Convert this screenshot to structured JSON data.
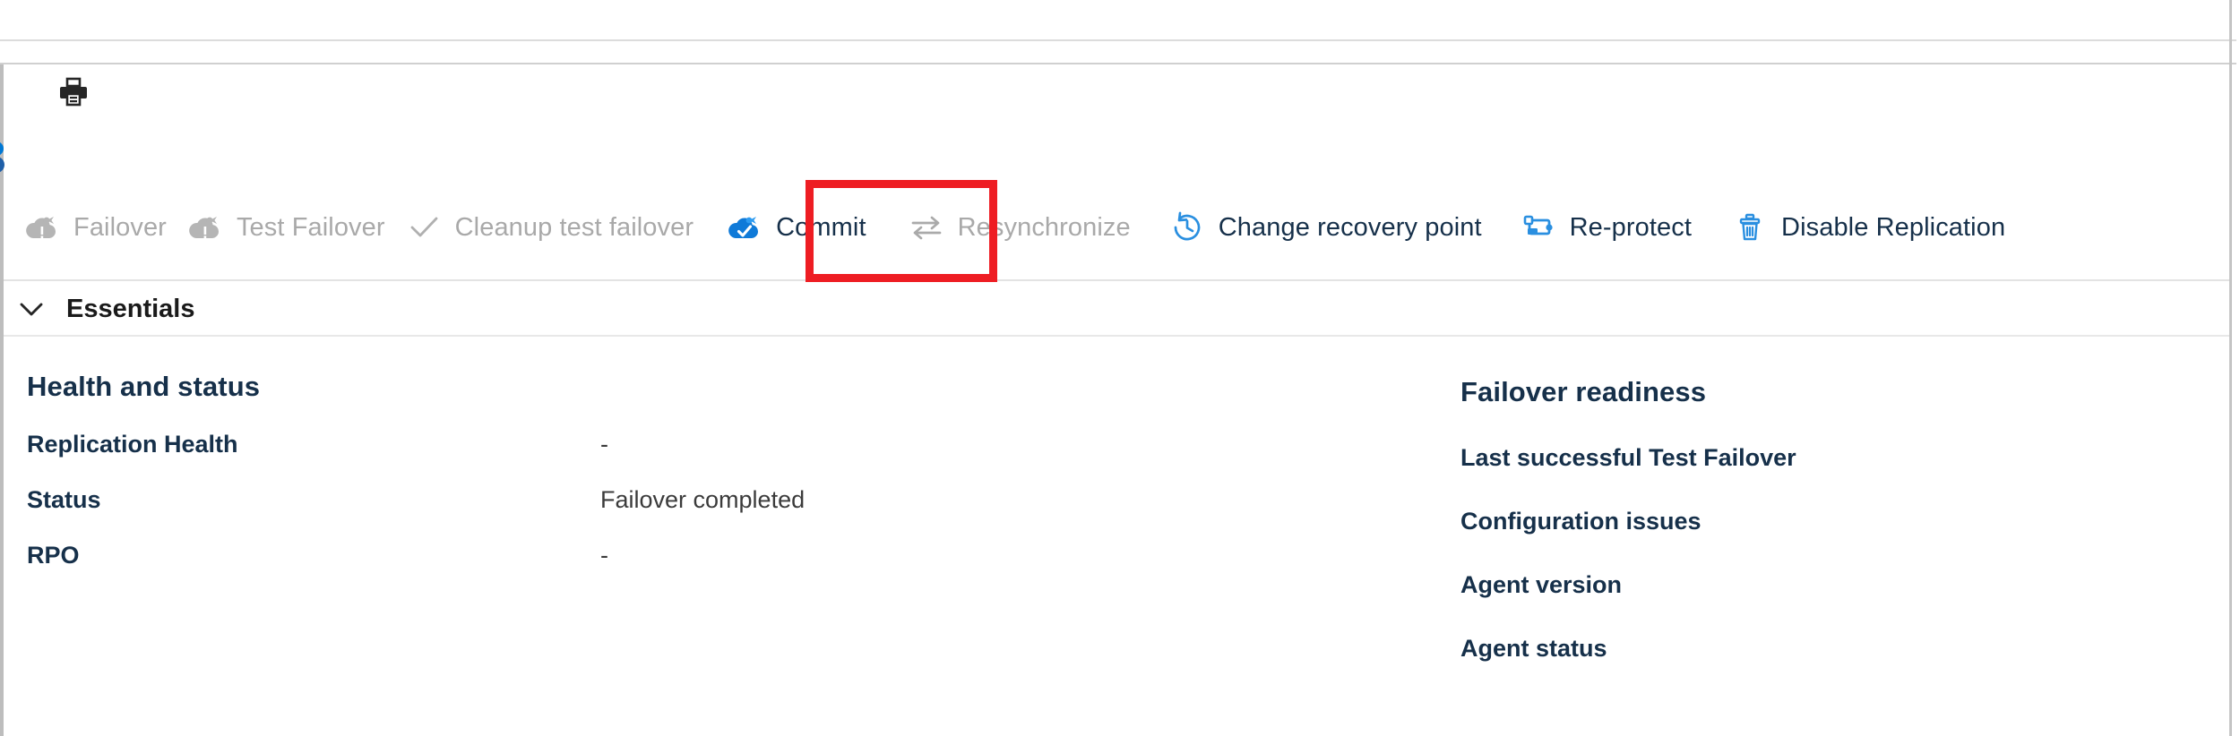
{
  "toolbar": {
    "print_icon": "print-icon",
    "actions": [
      {
        "label": "Failover",
        "icon": "failover-cloud-icon",
        "enabled": false
      },
      {
        "label": "Test Failover",
        "icon": "test-failover-cloud-icon",
        "enabled": false
      },
      {
        "label": "Cleanup test failover",
        "icon": "checkmark-icon",
        "enabled": false
      },
      {
        "label": "Commit",
        "icon": "commit-cloud-check-icon",
        "enabled": true
      },
      {
        "label": "Resynchronize",
        "icon": "resynchronize-arrows-icon",
        "enabled": false
      },
      {
        "label": "Change recovery point",
        "icon": "history-clock-icon",
        "enabled": true
      },
      {
        "label": "Re-protect",
        "icon": "re-protect-icon",
        "enabled": true
      },
      {
        "label": "Disable Replication",
        "icon": "trash-icon",
        "enabled": true
      }
    ],
    "highlight": {
      "target": "Commit",
      "color": "#ee1d23"
    }
  },
  "essentials": {
    "label": "Essentials",
    "chevron_icon": "chevron-down-icon",
    "expanded": true
  },
  "health_and_status": {
    "title": "Health and status",
    "rows": [
      {
        "key": "Replication Health",
        "value": "-"
      },
      {
        "key": "Status",
        "value": "Failover completed"
      },
      {
        "key": "RPO",
        "value": "-"
      }
    ]
  },
  "failover_readiness": {
    "title": "Failover readiness",
    "rows": [
      {
        "key": "Last successful Test Failover",
        "value": ""
      },
      {
        "key": "Configuration issues",
        "value": ""
      },
      {
        "key": "Agent version",
        "value": ""
      },
      {
        "key": "Agent status",
        "value": ""
      }
    ]
  },
  "colors": {
    "accent_blue": "#0078d4",
    "disabled_gray": "#a9a9a9",
    "text_dark": "#16304a",
    "highlight_red": "#ee1d23"
  }
}
